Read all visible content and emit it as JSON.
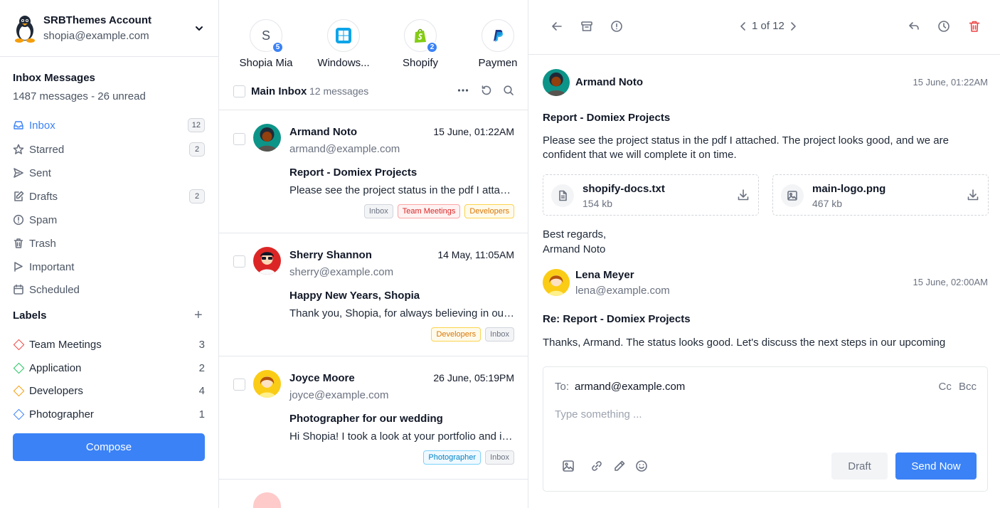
{
  "account": {
    "name": "SRBThemes Account",
    "email": "shopia@example.com"
  },
  "inbox": {
    "title": "Inbox Messages",
    "summary": "1487 messages - 26 unread"
  },
  "nav": [
    {
      "label": "Inbox",
      "count": "12",
      "icon": "inbox-icon"
    },
    {
      "label": "Starred",
      "count": "2",
      "icon": "star-icon"
    },
    {
      "label": "Sent",
      "count": "",
      "icon": "send-icon"
    },
    {
      "label": "Drafts",
      "count": "2",
      "icon": "edit-icon"
    },
    {
      "label": "Spam",
      "count": "",
      "icon": "alert-circle-icon"
    },
    {
      "label": "Trash",
      "count": "",
      "icon": "trash-icon"
    },
    {
      "label": "Important",
      "count": "",
      "icon": "flag-icon"
    },
    {
      "label": "Scheduled",
      "count": "",
      "icon": "calendar-icon"
    }
  ],
  "labels": {
    "title": "Labels",
    "items": [
      {
        "label": "Team Meetings",
        "count": "3",
        "color": "#ef4444"
      },
      {
        "label": "Application",
        "count": "2",
        "color": "#22c55e"
      },
      {
        "label": "Developers",
        "count": "4",
        "color": "#f59e0b"
      },
      {
        "label": "Photographer",
        "count": "1",
        "color": "#3b82f6"
      }
    ]
  },
  "compose_label": "Compose",
  "contacts": [
    {
      "name": "Shopia Mia",
      "letter": "S",
      "badge": "5",
      "icon": "letter-avatar"
    },
    {
      "name": "Windows...",
      "icon": "windows-icon"
    },
    {
      "name": "Shopify",
      "badge": "2",
      "icon": "shopify-icon"
    },
    {
      "name": "Paymen",
      "icon": "paypal-icon"
    }
  ],
  "list": {
    "title": "Main Inbox",
    "count_text": "12 messages"
  },
  "messages": [
    {
      "from": "Armand Noto",
      "date": "15 June, 01:22AM",
      "email": "armand@example.com",
      "subject": "Report - Domiex Projects",
      "preview": "Please see the project status in the pdf I attached. The project looks good",
      "tags": [
        "Inbox",
        "Team Meetings",
        "Developers"
      ]
    },
    {
      "from": "Sherry Shannon",
      "date": "14 May, 11:05AM",
      "email": "sherry@example.com",
      "subject": "Happy New Years, Shopia",
      "preview": "Thank you, Shopia, for always believing in our work and vision",
      "tags": [
        "Developers",
        "Inbox"
      ]
    },
    {
      "from": "Joyce Moore",
      "date": "26 June, 05:19PM",
      "email": "joyce@example.com",
      "subject": "Photographer for our wedding",
      "preview": "Hi Shopia! I took a look at your portfolio and it looks amazing",
      "tags": [
        "Photographer",
        "Inbox"
      ]
    }
  ],
  "detail": {
    "pager": "1 of 12",
    "sender": "Armand Noto",
    "date": "15 June, 01:22AM",
    "subject": "Report - Domiex Projects",
    "body": "Please see the project status in the pdf I attached. The project looks good, and we are confident that we will complete it on time.",
    "attachments": [
      {
        "name": "shopify-docs.txt",
        "size": "154 kb",
        "icon": "file-icon"
      },
      {
        "name": "main-logo.png",
        "size": "467 kb",
        "icon": "image-icon"
      }
    ],
    "signoff1": "Best regards,",
    "signoff2": "Armand Noto",
    "reply_sender": "Lena Meyer",
    "reply_email": "lena@example.com",
    "reply_date": "15 June, 02:00AM",
    "reply_subject": "Re: Report - Domiex Projects",
    "reply_body": "Thanks, Armand. The status looks good. Let's discuss the next steps in our upcoming"
  },
  "composer": {
    "to_label": "To:",
    "to": "armand@example.com",
    "cc_bcc": "Cc Bcc",
    "placeholder": "Type something ...",
    "draft_label": "Draft",
    "send_label": "Send Now"
  }
}
